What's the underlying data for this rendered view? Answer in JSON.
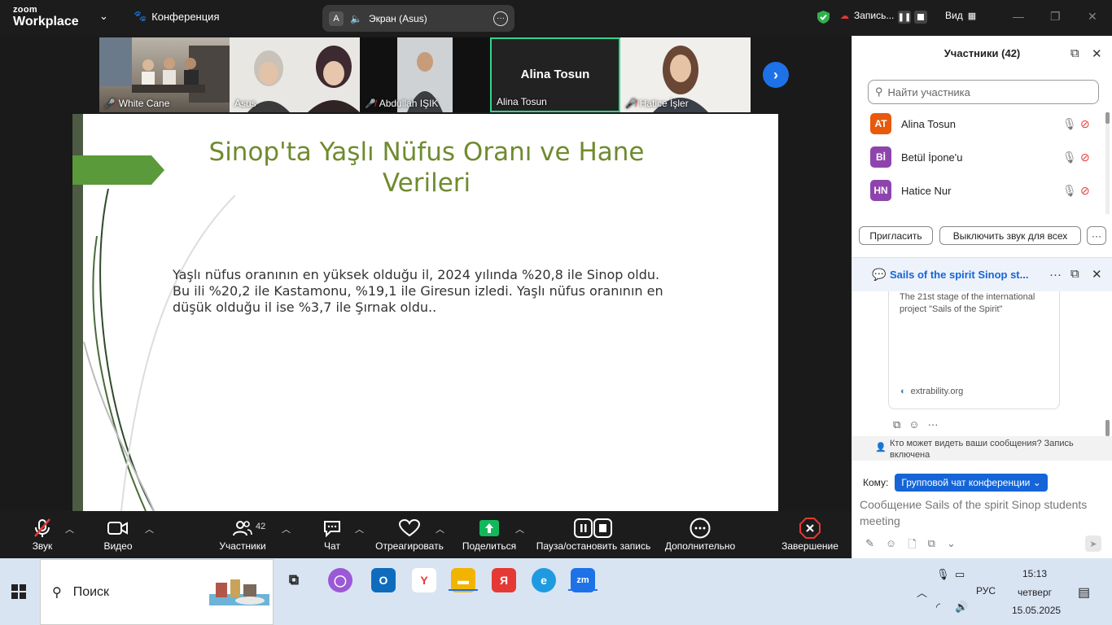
{
  "app": {
    "logo_line1": "zoom",
    "logo_line2": "Workplace",
    "meeting_menu": "Конференция",
    "share_avatar": "A",
    "share_label": "Экран (Asus)",
    "record_label": "Запись...",
    "view_label": "Вид"
  },
  "videos": [
    {
      "name": "White Cane",
      "muted": true
    },
    {
      "name": "Asus",
      "muted": false
    },
    {
      "name": "Abdullah IŞIK",
      "muted": true
    },
    {
      "name": "Alina Tosun",
      "muted": false,
      "big": "Alina Tosun"
    },
    {
      "name": "Hatice İşler",
      "muted": true
    }
  ],
  "slide": {
    "title": "Sinop'ta Yaşlı Nüfus Oranı ve Hane Verileri",
    "body": "Yaşlı nüfus oranının en yüksek olduğu il, 2024 yılında %20,8 ile Sinop oldu. Bu ili %20,2 ile Kastamonu, %19,1 ile Giresun izledi. Yaşlı nüfus oranının en düşük olduğu il ise %3,7 ile Şırnak oldu.."
  },
  "controls": {
    "audio": "Звук",
    "video": "Видео",
    "participants": "Участники",
    "participants_count": "42",
    "chat": "Чат",
    "react": "Отреагировать",
    "share": "Поделиться",
    "record": "Пауза/остановить запись",
    "more": "Дополнительно",
    "end": "Завершение"
  },
  "panel": {
    "title": "Участники (42)",
    "search_placeholder": "Найти участника",
    "participants": [
      {
        "initials": "AT",
        "name": "Alina Tosun",
        "color": "#e8590c"
      },
      {
        "initials": "Bİ",
        "name": "Betül İpone'u",
        "color": "#8e44ad"
      },
      {
        "initials": "HN",
        "name": "Hatice Nur",
        "color": "#8e44ad"
      }
    ],
    "invite": "Пригласить",
    "mute_all": "Выключить звук для всех",
    "chat_title": "Sails of the spirit Sinop st...",
    "card_text": "The 21st stage of the international project \"Sails of the Spirit\"",
    "card_link": "extrability.org",
    "who_sees": "Кто может видеть ваши сообщения? Запись включена",
    "to_label": "Кому:",
    "to_value": "Групповой чат конференции",
    "message_placeholder": "Сообщение Sails of the spirit Sinop students meeting"
  },
  "taskbar": {
    "search": "Поиск",
    "lang": "РУС",
    "time": "15:13",
    "day": "четверг",
    "date": "15.05.2025"
  }
}
